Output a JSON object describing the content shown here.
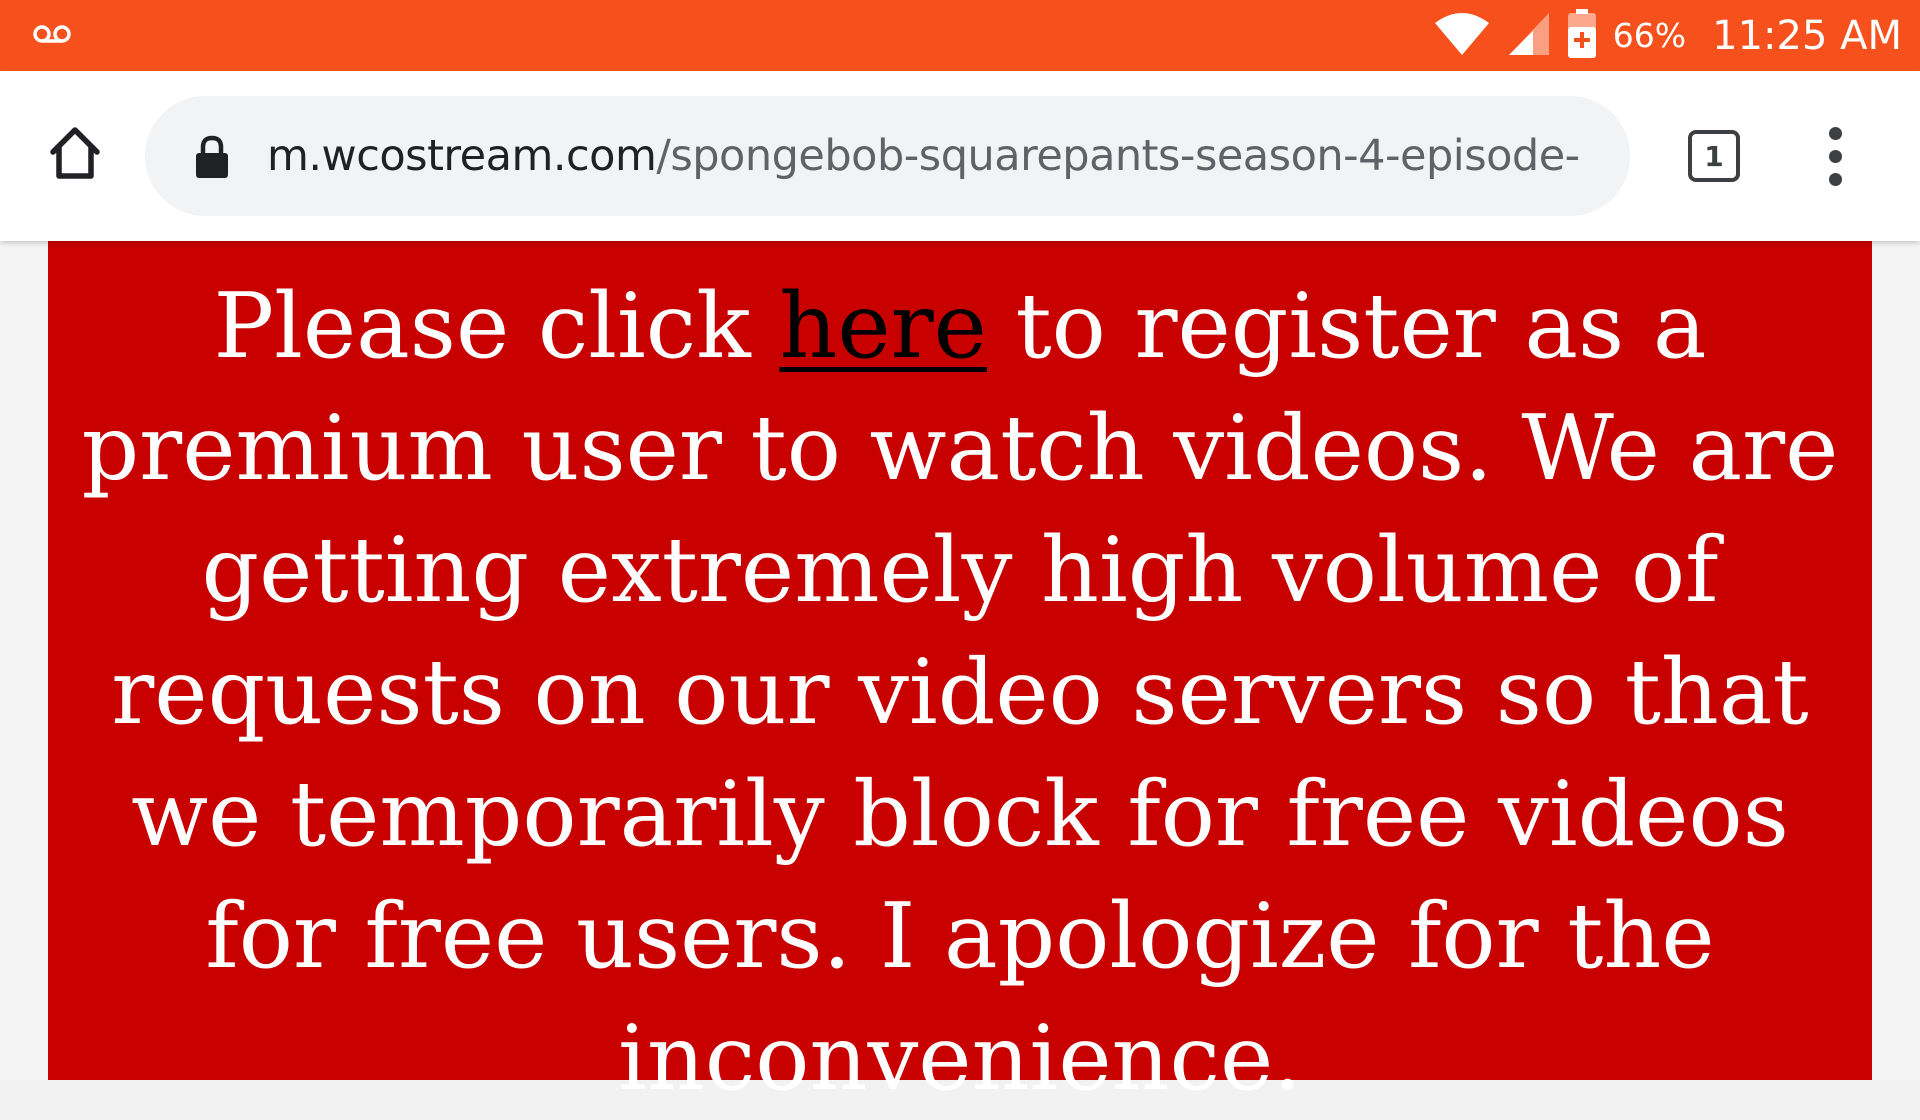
{
  "status_bar": {
    "voicemail_icon": "voicemail-icon",
    "wifi_icon": "wifi-icon",
    "signal_icon": "cell-signal-icon",
    "battery_icon": "battery-charging-icon",
    "battery_percent": "66%",
    "time": "11:25 AM",
    "color": "#f6511d"
  },
  "toolbar": {
    "home_icon": "home-icon",
    "lock_icon": "lock-icon",
    "url_host": "m.wcostream.com",
    "url_path": "/spongebob-squarepants-season-4-episode-",
    "tab_count": "1",
    "menu_icon": "more-vert-icon"
  },
  "notice": {
    "background": "#c80000",
    "text_before_link": "Please click ",
    "link_text": "here",
    "text_after_link": " to register as a premium user to watch videos. We are getting extremely high volume of requests on our video servers so that we temporarily block for free videos for free users. I apologize for the inconvenience."
  }
}
